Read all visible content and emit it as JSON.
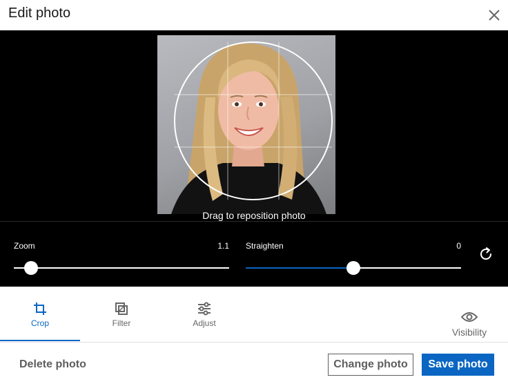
{
  "header": {
    "title": "Edit photo",
    "close_icon": "close-icon"
  },
  "editor": {
    "drag_hint": "Drag to reposition photo"
  },
  "controls": {
    "zoom": {
      "label": "Zoom",
      "value": "1.1",
      "level": 0.08
    },
    "straighten": {
      "label": "Straighten",
      "value": "0",
      "level": 0.5
    },
    "reset_icon": "rotate-reset-icon"
  },
  "tabs": [
    {
      "label": "Crop",
      "icon": "crop-icon",
      "active": true
    },
    {
      "label": "Filter",
      "icon": "filter-icon",
      "active": false
    },
    {
      "label": "Adjust",
      "icon": "adjust-sliders-icon",
      "active": false
    }
  ],
  "visibility": {
    "label": "Visibility",
    "icon": "eye-icon"
  },
  "footer": {
    "delete_label": "Delete photo",
    "change_label": "Change photo",
    "save_label": "Save photo"
  },
  "colors": {
    "accent": "#0a66c2",
    "editor_bg": "#000000"
  }
}
